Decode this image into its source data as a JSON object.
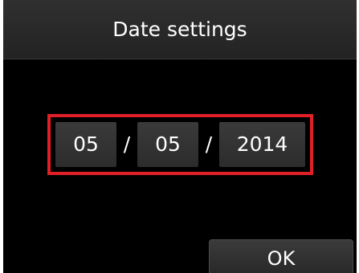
{
  "header": {
    "title": "Date settings"
  },
  "date": {
    "month": "05",
    "day": "05",
    "year": "2014",
    "separator": "/"
  },
  "actions": {
    "ok_label": "OK"
  },
  "colors": {
    "background": "#000000",
    "highlight": "#e01f26",
    "field": "#333333",
    "text": "#ffffff"
  }
}
